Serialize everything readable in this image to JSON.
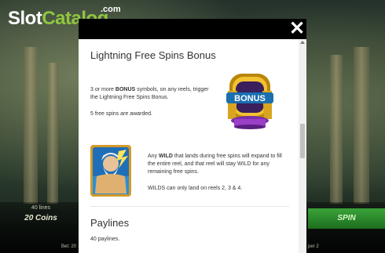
{
  "logo": {
    "slot": "Slot",
    "catalog": "Catalog",
    "com": ".com"
  },
  "modal": {
    "close_label": "✕",
    "section1": {
      "title": "Lightning Free Spins Bonus",
      "para1_pre": "3 or more ",
      "para1_bold": "BONUS",
      "para1_post": " symbols, on any reels, trigger the Lightning Free Spins Bonus.",
      "para2": "5 free spins are awarded.",
      "bonus_symbol_text": "BONUS"
    },
    "section2": {
      "para3_pre": "Any ",
      "para3_bold": "WILD",
      "para3_post": " that lands during free spins will expand to fill the entire reel, and that reel will stay WILD for any remaining free spins.",
      "para4": "WILDS can only land on reels 2, 3 & 4."
    },
    "section3": {
      "title": "Paylines",
      "para5": "40 paylines."
    }
  },
  "game": {
    "lines_label": "40 lines",
    "coins_value": "20 Coins",
    "spin_label": "SPIN",
    "bet_label": "Bet: 20",
    "line_label": "per 2"
  },
  "colors": {
    "brand_green": "#8fc63f",
    "modal_header": "#000000",
    "spin_green": "#2f8f2f"
  }
}
